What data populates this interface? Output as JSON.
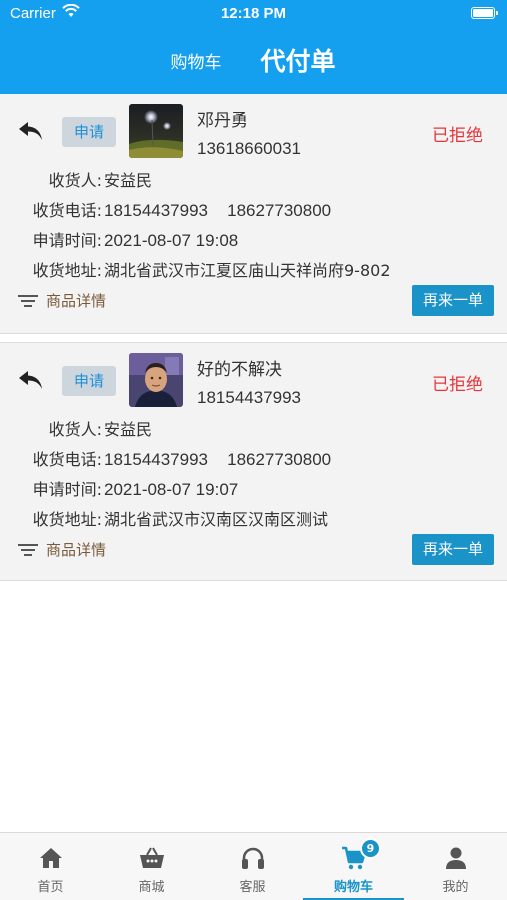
{
  "status_bar": {
    "carrier": "Carrier",
    "time": "12:18 PM"
  },
  "header": {
    "tab_cart": "购物车",
    "tab_proxy": "代付单"
  },
  "labels": {
    "apply": "申请",
    "receiver": "收货人:",
    "receiver_phone": "收货电话:",
    "apply_time": "申请时间:",
    "address": "收货地址:",
    "product_detail": "商品详情",
    "reorder": "再来一单"
  },
  "orders": [
    {
      "buyer_name": "邓丹勇",
      "buyer_phone": "13618660031",
      "status": "已拒绝",
      "receiver": "安益民",
      "phone_1": "18154437993",
      "phone_2": "18627730800",
      "apply_time": "2021-08-07 19:08",
      "address": "湖北省武汉市江夏区庙山天祥尚府9-802"
    },
    {
      "buyer_name": "好的不解决",
      "buyer_phone": "18154437993",
      "status": "已拒绝",
      "receiver": "安益民",
      "phone_1": "18154437993",
      "phone_2": "18627730800",
      "apply_time": "2021-08-07 19:07",
      "address": "湖北省武汉市汉南区汉南区测试"
    }
  ],
  "tabbar": {
    "items": [
      {
        "label": "首页",
        "icon": "home-icon"
      },
      {
        "label": "商城",
        "icon": "basket-icon"
      },
      {
        "label": "客服",
        "icon": "headset-icon"
      },
      {
        "label": "购物车",
        "icon": "cart-icon",
        "badge": "9",
        "active": true
      },
      {
        "label": "我的",
        "icon": "person-icon"
      }
    ]
  },
  "colors": {
    "header_bg": "#14a0ee",
    "accent": "#1a94c8",
    "status_rejected": "#e6363c",
    "card_bg": "#f3f3f3"
  }
}
